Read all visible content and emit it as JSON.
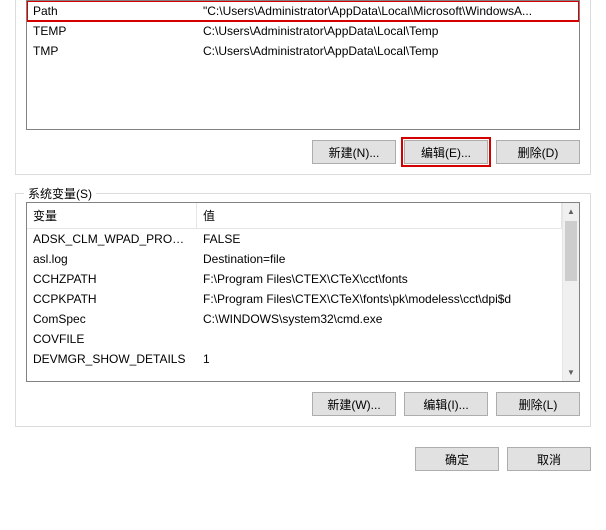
{
  "userVars": {
    "rows": [
      {
        "name": "Path",
        "value": "\"C:\\Users\\Administrator\\AppData\\Local\\Microsoft\\WindowsA...",
        "selected": true
      },
      {
        "name": "TEMP",
        "value": "C:\\Users\\Administrator\\AppData\\Local\\Temp",
        "selected": false
      },
      {
        "name": "TMP",
        "value": "C:\\Users\\Administrator\\AppData\\Local\\Temp",
        "selected": false
      }
    ],
    "buttons": {
      "new": "新建(N)...",
      "edit": "编辑(E)...",
      "delete": "删除(D)"
    }
  },
  "systemVars": {
    "label": "系统变量(S)",
    "header": {
      "variable": "变量",
      "value": "值"
    },
    "rows": [
      {
        "name": "ADSK_CLM_WPAD_PROXY...",
        "value": "FALSE"
      },
      {
        "name": "asl.log",
        "value": "Destination=file"
      },
      {
        "name": "CCHZPATH",
        "value": "F:\\Program Files\\CTEX\\CTeX\\cct\\fonts"
      },
      {
        "name": "CCPKPATH",
        "value": "F:\\Program Files\\CTEX\\CTeX\\fonts\\pk\\modeless\\cct\\dpi$d"
      },
      {
        "name": "ComSpec",
        "value": "C:\\WINDOWS\\system32\\cmd.exe"
      },
      {
        "name": "COVFILE",
        "value": ""
      },
      {
        "name": "DEVMGR_SHOW_DETAILS",
        "value": "1"
      }
    ],
    "buttons": {
      "new": "新建(W)...",
      "edit": "编辑(I)...",
      "delete": "删除(L)"
    }
  },
  "dialogButtons": {
    "ok": "确定",
    "cancel": "取消"
  }
}
